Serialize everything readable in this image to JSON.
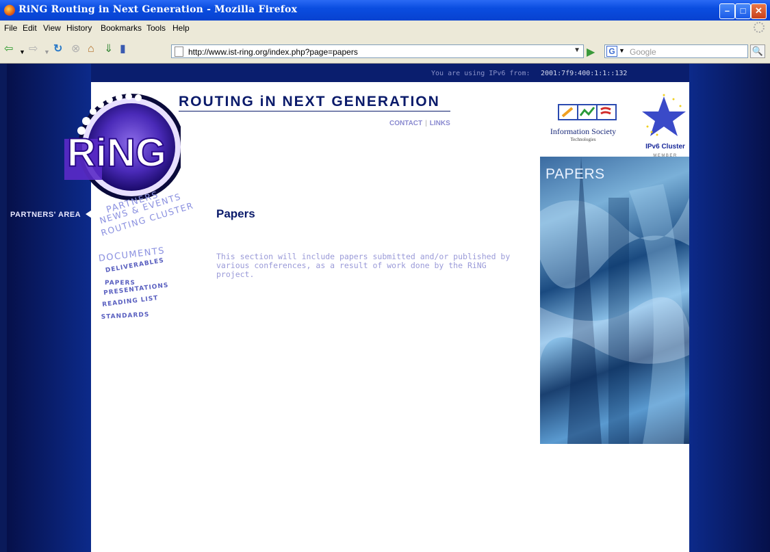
{
  "window": {
    "title": "RiNG Routing in Next Generation - Mozilla Firefox"
  },
  "menu": [
    "File",
    "Edit",
    "View",
    "History",
    "Bookmarks",
    "Tools",
    "Help"
  ],
  "toolbar": {
    "url": "http://www.ist-ring.org/index.php?page=papers",
    "search_placeholder": "Google"
  },
  "page": {
    "ipv6_label": "You are using IPv6 from:",
    "ipv6_address": "2001:7f9:400:1:1::132",
    "logo_text": "RiNG",
    "header_title": "ROUTING iN NEXT GENERATION",
    "header_links": [
      "CONTACT",
      "LINKS"
    ],
    "partners_area": "PARTNERS' AREA",
    "nav": {
      "partners": "PARTNERS",
      "news": "NEWS & EVENTS",
      "routing_cluster": "ROUTING CLUSTER",
      "documents": "DOCUMENTS",
      "deliverables": "DELIVERABLES",
      "papers": "PAPERS",
      "presentations": "PRESENTATIONS",
      "reading_list": "READING LIST",
      "standards": "STANDARDS"
    },
    "heading": "Papers",
    "description": "This section will include papers submitted and/or published by various conferences, as a result of work done by the RiNG project.",
    "ist": {
      "name": "Information Society",
      "sub": "Technologies"
    },
    "cluster": {
      "name": "IPv6 Cluster",
      "sub": "MEMBER"
    },
    "banner_label": "PAPERS"
  }
}
